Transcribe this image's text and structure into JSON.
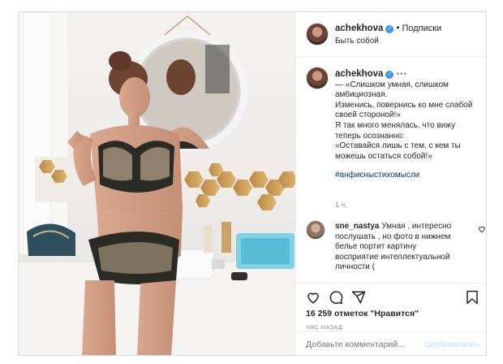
{
  "post": {
    "username": "achekhova",
    "follow_label": "Подписки",
    "location": "Быть собой",
    "caption": {
      "username": "achekhova",
      "more": "•••",
      "lines": [
        "— «Слишком умная, слишком амбициозная.",
        "Изменись, повернись ко мне слабой своей стороной!»",
        "Я так много менялась, что вижу теперь осознанно:",
        "«Оставайся лишь с тем, с кем ты можешь остаться собой!»"
      ],
      "hashtag": "#анфисныстихомысли",
      "time": "1 ч."
    },
    "comment": {
      "username": "sne_nastya",
      "text": "Умная , интересно послушать , но фото в нижнем белье портит картину восприятие интеллектуальной личности ("
    },
    "likes": "16 259 отметок \"Нравится\"",
    "time_ago": "ЧАС НАЗАД",
    "add_comment_placeholder": "Добавьте комментарий...",
    "publish_label": "Опубликовать"
  },
  "icons": {
    "verified": "verified-icon",
    "heart": "heart-icon",
    "comment": "comment-icon",
    "share": "share-icon",
    "bookmark": "bookmark-icon"
  },
  "colors": {
    "verified": "#3897f0",
    "hashtag": "#00376b",
    "publish_disabled": "#b2dffc",
    "muted": "#8e8e8e"
  }
}
